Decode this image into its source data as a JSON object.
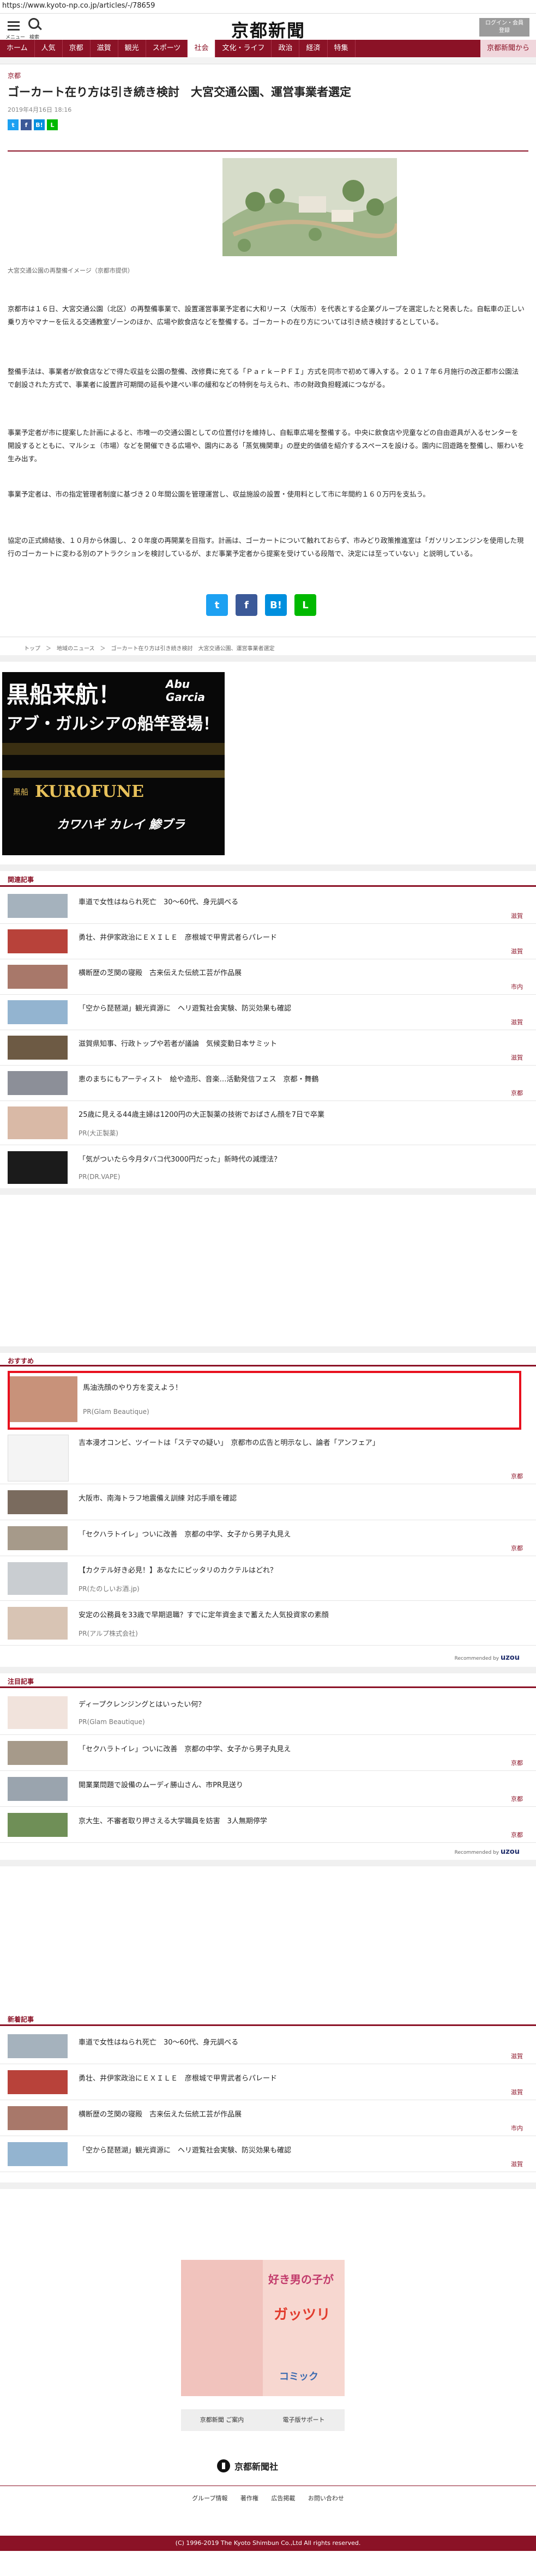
{
  "url": "https://www.kyoto-np.co.jp/articles/-/78659",
  "header": {
    "menu_label": "メニュー",
    "search_label": "検索",
    "logo": "京都新聞",
    "login_line1": "ログイン・会員",
    "login_line2": "登録"
  },
  "nav": [
    {
      "label": "ホーム"
    },
    {
      "label": "人気"
    },
    {
      "label": "京都"
    },
    {
      "label": "滋賀"
    },
    {
      "label": "観光"
    },
    {
      "label": "スポーツ"
    },
    {
      "label": "社会"
    },
    {
      "label": "文化・ライフ"
    },
    {
      "label": "政治"
    },
    {
      "label": "経済"
    },
    {
      "label": "特集"
    },
    {
      "label": "京都新聞から"
    }
  ],
  "article": {
    "section": "京都",
    "title": "ゴーカート在り方は引き続き検討　大宮交通公園、運営事業者選定",
    "date": "2019年4月16日 18:16",
    "caption": "大宮交通公園の再整備イメージ（京都市提供）",
    "p1": "京都市は１６日、大宮交通公園（北区）の再整備事業で、設置運営事業予定者に大和リース（大阪市）を代表とする企業グループを選定したと発表した。自転車の正しい乗り方やマナーを伝える交通教室ゾーンのほか、広場や飲食店などを整備する。ゴーカートの在り方については引き続き検討するとしている。",
    "p2": "整備手法は、事業者が飲食店などで得た収益を公園の整備、改修費に充てる「Ｐａｒｋ－ＰＦＩ」方式を同市で初めて導入する。２０１７年６月施行の改正都市公園法で創設された方式で、事業者に設置許可期間の延長や建ぺい率の緩和などの特例を与えられ、市の財政負担軽減につながる。",
    "p3": "事業予定者が市に提案した計画によると、市唯一の交通公園としての位置付けを維持し、自転車広場を整備する。中央に飲食店や児童などの自由遊具が入るセンターを開設するとともに、マルシェ（市場）などを開催できる広場や、園内にある「蒸気機関車」の歴史的価値を紹介するスペースを設ける。園内に回遊路を整備し、賑わいを生み出す。",
    "p4": "事業予定者は、市の指定管理者制度に基づき２０年間公園を管理運営し、収益施設の設置・使用料として市に年間約１６０万円を支払う。",
    "p5": "協定の正式締結後、１０月から休園し、２０年度の再開業を目指す。計画は、ゴーカートについて触れておらず、市みどり政策推進室は「ガソリンエンジンを使用した現行のゴーカートに変わる別のアトラクションを検討しているが、まだ事業予定者から提案を受けている段階で、決定には至っていない」と説明している。"
  },
  "share": {
    "twitter": "t",
    "facebook": "f",
    "hatena": "B!",
    "line": "L"
  },
  "breadcrumb": "トップ　＞　地域のニュース　＞　ゴーカート在り方は引き続き検討　大宮交通公園、運営事業者選定",
  "ad1": {
    "line1": "黒船来航！",
    "line2": "アブ・ガルシアの船竿登場！",
    "brand": "Abu Garcia",
    "product": "KUROFUNE",
    "sub": "黒船",
    "tagline": "カワハギ カレイ 鯵ブラ"
  },
  "related": {
    "title": "関連記事",
    "items": [
      {
        "title": "車道で女性はねられ死亡　30～60代、身元調べる",
        "tag": "滋賀"
      },
      {
        "title": "勇壮、井伊家政治にＥＸＩＬＥ　彦根城で甲冑武者らパレード",
        "tag": "滋賀"
      },
      {
        "title": "横断歴の芝関の寝殿　古来伝えた伝統工芸が作品展",
        "tag": "市内"
      },
      {
        "title": "「空から琵琶湖」観光資源に　ヘリ遊覧社会実験、防災効果も確認",
        "tag": "滋賀"
      },
      {
        "title": "滋賀県知事、行政トップや若者が議論　気候変動日本サミット",
        "tag": "滋賀"
      },
      {
        "title": "恵のまちにもアーティスト　絵や造形、音楽…活動発信フェス　京都・舞鶴",
        "tag": "京都"
      },
      {
        "title": "25歳に見える44歳主婦は1200円の大正製薬の技術でおばさん顔を7日で卒業",
        "pr": "PR(大正製薬)"
      },
      {
        "title": "「気がついたら今月タバコ代3000円だった」新時代の減煙法？",
        "pr": "PR(DR.VAPE)"
      }
    ]
  },
  "recommend": {
    "title": "おすすめ",
    "items": [
      {
        "title": "馬油洗顔のやり方を変えよう！",
        "pr": "PR(Glam Beautique)"
      },
      {
        "title": "吉本漫才コンビ、ツイートは「ステマの疑い」　京都市の広告と明示なし、論者「アンフェア」",
        "tag": "京都"
      },
      {
        "title": "大阪市、南海トラフ地震備え訓練 対応手順を確認",
        "tag": ""
      },
      {
        "title": "「セクハラトイレ」ついに改善　京都の中学、女子から男子丸見え",
        "tag": "京都"
      },
      {
        "title": "【カクテル好き必見！】あなたにピッタリのカクテルはどれ？",
        "pr": "PR(たのしいお酒.jp)"
      },
      {
        "title": "安定の公務員を33歳で早期退職？すでに定年資金まで蓄えた人気投資家の素顔",
        "pr": "PR(アルプ株式会社)"
      }
    ],
    "powered_label": "Recommended by",
    "powered_brand": "uzou"
  },
  "attention": {
    "title": "注目記事",
    "items": [
      {
        "title": "ディープクレンジングとはいったい何？",
        "pr": "PR(Glam Beautique)"
      },
      {
        "title": "「セクハラトイレ」ついに改善　京都の中学、女子から男子丸見え",
        "tag": "京都"
      },
      {
        "title": "開業業問題で設備のムーディ勝山さん、市PR見送り",
        "tag": "京都"
      },
      {
        "title": "京大生、不審者取り押さえる大学職員を妨害　3人無期停学",
        "tag": "京都"
      }
    ],
    "powered_label": "Recommended by",
    "powered_brand": "uzou"
  },
  "latest": {
    "title": "新着記事",
    "items": [
      {
        "title": "車道で女性はねられ死亡　30～60代、身元調べる",
        "tag": "滋賀"
      },
      {
        "title": "勇壮、井伊家政治にＥＸＩＬＥ　彦根城で甲冑武者らパレード",
        "tag": "滋賀"
      },
      {
        "title": "横断歴の芝関の寝殿　古来伝えた伝統工芸が作品展",
        "tag": "市内"
      },
      {
        "title": "「空から琵琶湖」観光資源に　ヘリ遊覧社会実験、防災効果も確認",
        "tag": "滋賀"
      }
    ]
  },
  "ad2": {
    "text1": "好き男の子が",
    "text2": "ガッツリ",
    "text3": "コミック"
  },
  "footer": {
    "btn1": "京都新聞 ご案内",
    "btn2": "電子版サポート",
    "logo": "京都新聞社",
    "links": [
      "グループ情報",
      "著作権",
      "広告掲載",
      "お問い合わせ"
    ],
    "copyright": "(C) 1996-2019 The Kyoto Shimbun Co.,Ltd All rights reserved."
  }
}
